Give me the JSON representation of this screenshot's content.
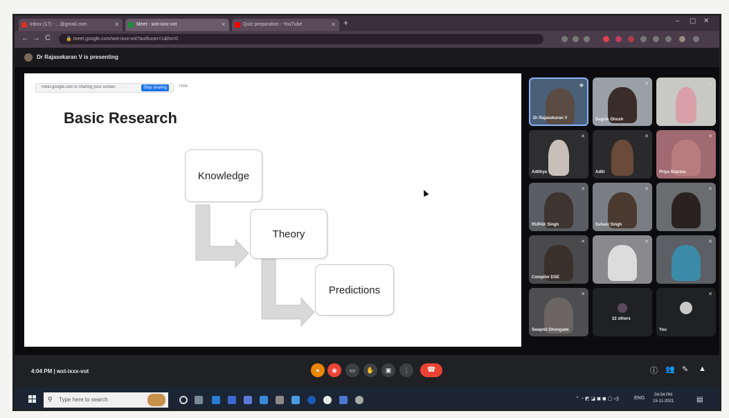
{
  "browser": {
    "tabs": [
      {
        "label": "Inbox (17) - ...@gmail.com",
        "active": false
      },
      {
        "label": "Meet - wxt-ixxx-vot",
        "active": true
      },
      {
        "label": "Quiz preparation - YouTube",
        "active": false
      }
    ],
    "new_tab": "+",
    "address": "meet.google.com/wxt-ixxx-vot?authuser=1&hs=0",
    "nav": {
      "back": "←",
      "forward": "→",
      "reload": "C"
    }
  },
  "meet": {
    "presenting_text": "Dr Rajasekaran V is presenting",
    "meeting_info": "4:04 PM  |  wxt-ixxx-vot",
    "controls": [
      "mic",
      "camera",
      "captions",
      "raise-hand",
      "present",
      "more",
      "end-call"
    ],
    "participants": [
      {
        "name": "Dr Rajasekaran V"
      },
      {
        "name": "Sagnik Ghosh"
      },
      {
        "name": ""
      },
      {
        "name": "Adithya"
      },
      {
        "name": "Aditi"
      },
      {
        "name": "Priya Sharma"
      },
      {
        "name": "RUPAK Singh"
      },
      {
        "name": "Suhani Singh"
      },
      {
        "name": ""
      },
      {
        "name": "Compiler DSE"
      },
      {
        "name": ""
      },
      {
        "name": ""
      },
      {
        "name": "Swapnil Dhongade"
      },
      {
        "name": "22 others"
      },
      {
        "name": "You"
      }
    ]
  },
  "slide": {
    "share_url": "meet.google.com is sharing your screen.",
    "stop_label": "Stop sharing",
    "hide_label": "Hide",
    "title": "Basic Research",
    "nodes": [
      "Knowledge",
      "Theory",
      "Predictions"
    ],
    "colors": {
      "arrow": "#d9d9d9",
      "node_border": "#c8c8c8"
    }
  },
  "taskbar": {
    "search_placeholder": "Type here to search",
    "lang": "ENG",
    "time": "04:04 PM",
    "date": "15-11-2021"
  }
}
